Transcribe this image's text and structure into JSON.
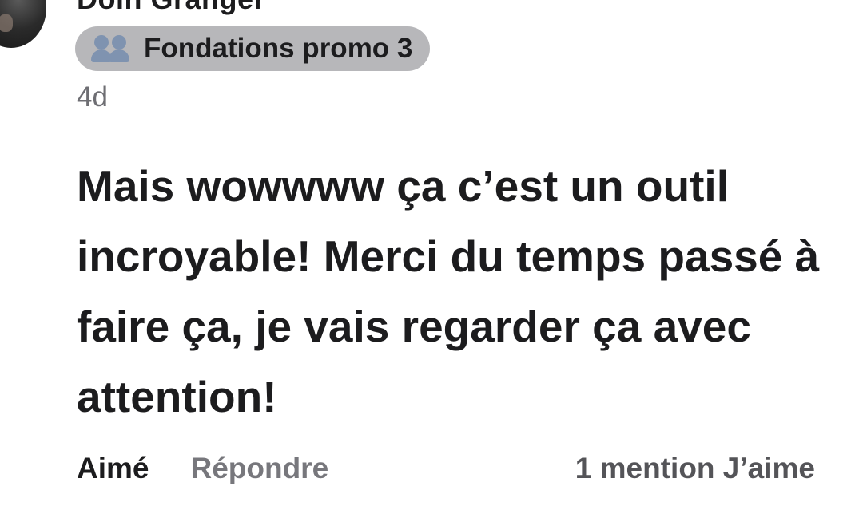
{
  "comment": {
    "author_name": "Doin Granger",
    "group": {
      "label": "Fondations promo 3",
      "icon": "group-icon"
    },
    "timestamp": "4d",
    "text": "Mais wowwww ça c’est un outil incroyable! Merci du temps passé à faire ça, je vais regarder ça avec attention!"
  },
  "actions": {
    "like_label": "Aimé",
    "reply_label": "Répondre",
    "likes_count_label": "1 mention J’aime"
  },
  "colors": {
    "text_primary": "#1c1c1e",
    "text_secondary": "#6e6e73",
    "badge_background": "#b7b7ba",
    "icon_blue": "#7f93b0"
  }
}
